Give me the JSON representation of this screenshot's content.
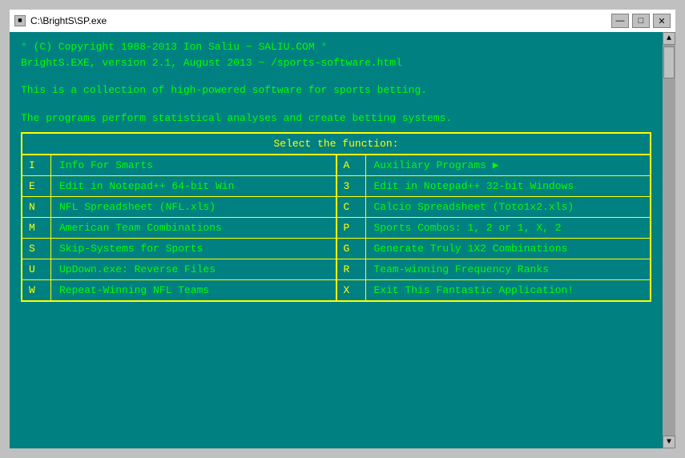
{
  "window": {
    "title": "C:\\BrightS\\SP.exe",
    "title_icon": "■"
  },
  "title_buttons": {
    "minimize": "—",
    "maximize": "□",
    "close": "✕"
  },
  "header": {
    "line1": "° (C) Copyright 1988-2013 Ion Saliu ~ SALIU.COM °",
    "line2": "BrightS.EXE, version 2.1, August 2013 ~ /sports-software.html",
    "line3": "This is a collection of high-powered software for sports betting.",
    "line4": "The programs perform statistical analyses and create betting systems."
  },
  "menu": {
    "header": "Select the function:",
    "rows": [
      {
        "key1": "I",
        "label1": "Info For Smarts",
        "key2": "A",
        "label2": "Auxiliary Programs ▶",
        "has_arrow": true
      },
      {
        "key1": "E",
        "label1": "Edit in Notepad++ 64-bit Win",
        "key2": "3",
        "label2": "Edit in Notepad++ 32-bit Windows"
      },
      {
        "key1": "N",
        "label1": "NFL Spreadsheet (NFL.xls)",
        "key2": "C",
        "label2": "Calcio Spreadsheet (Toto1x2.xls)"
      },
      {
        "key1": "M",
        "label1": "American Team Combinations",
        "key2": "P",
        "label2": "Sports Combos:  1, 2 or 1, X, 2"
      },
      {
        "key1": "S",
        "label1": "Skip-Systems for Sports",
        "key2": "G",
        "label2": "Generate Truly 1X2 Combinations"
      },
      {
        "key1": "U",
        "label1": "UpDown.exe: Reverse Files",
        "key2": "R",
        "label2": "Team-winning Frequency Ranks"
      },
      {
        "key1": "W",
        "label1": "Repeat-Winning NFL Teams",
        "key2": "X",
        "label2": "Exit This Fantastic Application!"
      }
    ]
  }
}
